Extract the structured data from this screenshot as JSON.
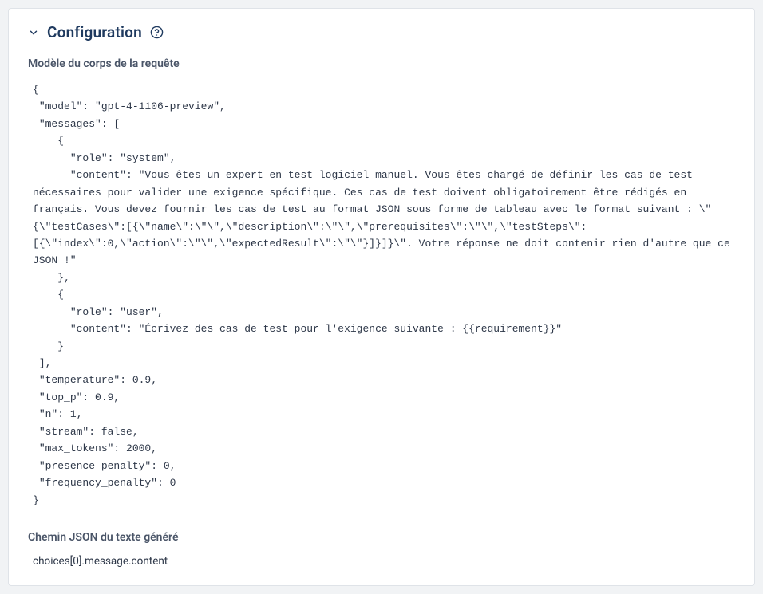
{
  "panel": {
    "title": "Configuration",
    "section_body_label": "Modèle du corps de la requête",
    "section_path_label": "Chemin JSON du texte généré",
    "body_template": "{\n \"model\": \"gpt-4-1106-preview\",\n \"messages\": [\n    {\n      \"role\": \"system\",\n      \"content\": \"Vous êtes un expert en test logiciel manuel. Vous êtes chargé de définir les cas de test nécessaires pour valider une exigence spécifique. Ces cas de test doivent obligatoirement être rédigés en français. Vous devez fournir les cas de test au format JSON sous forme de tableau avec le format suivant : \\\"{\\\"testCases\\\":[{\\\"name\\\":\\\"\\\",\\\"description\\\":\\\"\\\",\\\"prerequisites\\\":\\\"\\\",\\\"testSteps\\\":[{\\\"index\\\":0,\\\"action\\\":\\\"\\\",\\\"expectedResult\\\":\\\"\\\"}]}]}\\\". Votre réponse ne doit contenir rien d'autre que ce JSON !\"\n    },\n    {\n      \"role\": \"user\",\n      \"content\": \"Écrivez des cas de test pour l'exigence suivante : {{requirement}}\"\n    }\n ],\n \"temperature\": 0.9,\n \"top_p\": 0.9,\n \"n\": 1,\n \"stream\": false,\n \"max_tokens\": 2000,\n \"presence_penalty\": 0,\n \"frequency_penalty\": 0\n}",
    "json_path": "choices[0].message.content"
  }
}
